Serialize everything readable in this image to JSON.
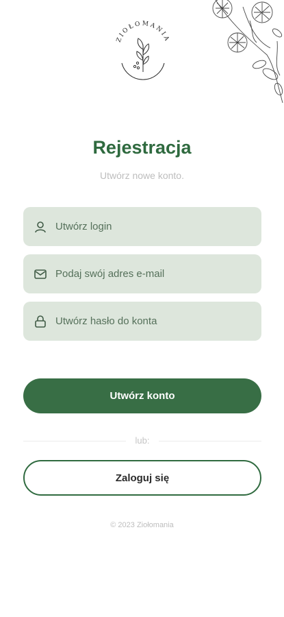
{
  "brand": {
    "name": "ZIOŁOMANIA"
  },
  "header": {
    "title": "Rejestracja",
    "subtitle": "Utwórz nowe konto."
  },
  "form": {
    "login": {
      "placeholder": "Utwórz login",
      "value": "",
      "icon": "user-icon"
    },
    "email": {
      "placeholder": "Podaj swój adres e-mail",
      "value": "",
      "icon": "mail-icon"
    },
    "password": {
      "placeholder": "Utwórz hasło do konta",
      "value": "",
      "icon": "lock-icon"
    },
    "submit_label": "Utwórz konto"
  },
  "divider": {
    "label": "lub:"
  },
  "login_button": {
    "label": "Zaloguj się"
  },
  "footer": {
    "text": "© 2023 Ziołomania"
  },
  "colors": {
    "accent": "#386e45",
    "title": "#2f6a3f",
    "field_bg": "#dde6dc"
  }
}
